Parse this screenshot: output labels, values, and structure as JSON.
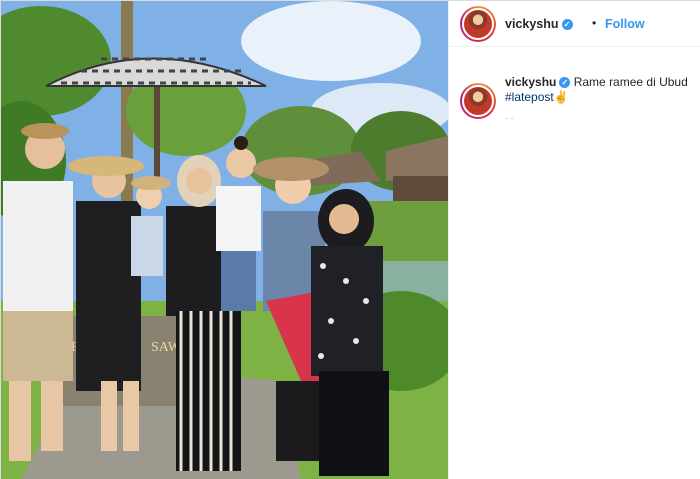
{
  "post": {
    "username": "vickyshu",
    "verified_icon": "verified-badge-icon",
    "separator": "•",
    "follow_label": "Follow",
    "caption_text": "Rame ramee di Ubud",
    "hashtag": "#latepost",
    "emoji": "✌",
    "timestamp": "· ·",
    "colors": {
      "accent": "#3897f0",
      "hashtag": "#003569",
      "border": "#dbdbdb"
    }
  }
}
